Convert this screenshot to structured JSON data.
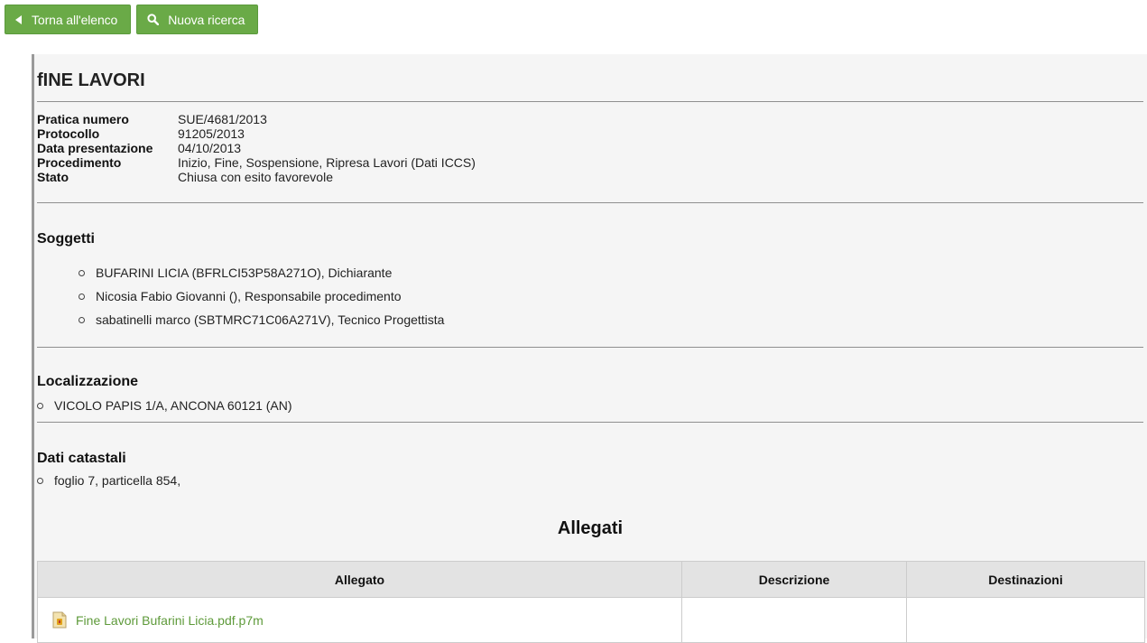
{
  "toolbar": {
    "back_label": "Torna all'elenco",
    "search_label": "Nuova ricerca",
    "back_icon": "triangle-left-icon",
    "search_icon": "search-icon",
    "accent_color": "#6aaa47"
  },
  "practice": {
    "title": "fINE LAVORI",
    "fields": [
      {
        "label": "Pratica numero",
        "value": "SUE/4681/2013"
      },
      {
        "label": "Protocollo",
        "value": "91205/2013"
      },
      {
        "label": "Data presentazione",
        "value": "04/10/2013"
      },
      {
        "label": "Procedimento",
        "value": "Inizio, Fine, Sospensione, Ripresa Lavori (Dati ICCS)"
      },
      {
        "label": "Stato",
        "value": "Chiusa con esito favorevole"
      }
    ]
  },
  "soggetti": {
    "heading": "Soggetti",
    "items": [
      "BUFARINI LICIA (BFRLCI53P58A271O), Dichiarante",
      "Nicosia Fabio Giovanni (), Responsabile procedimento",
      "sabatinelli marco (SBTMRC71C06A271V), Tecnico Progettista"
    ]
  },
  "localizzazione": {
    "heading": "Localizzazione",
    "items": [
      "VICOLO PAPIS 1/A, ANCONA 60121 (AN)"
    ]
  },
  "catastali": {
    "heading": "Dati catastali",
    "items": [
      "foglio 7, particella 854,"
    ]
  },
  "allegati": {
    "heading": "Allegati",
    "columns": [
      "Allegato",
      "Descrizione",
      "Destinazioni"
    ],
    "rows": [
      {
        "file": "Fine Lavori Bufarini Licia.pdf.p7m",
        "descrizione": "",
        "destinazioni": "",
        "icon": "signed-file-icon"
      }
    ]
  }
}
